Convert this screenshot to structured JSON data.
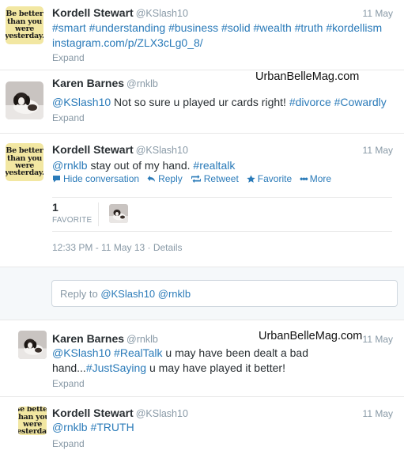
{
  "tweets": [
    {
      "fullname": "Kordell Stewart",
      "username": "@KSlash10",
      "time": "11 May",
      "line1": "#smart #understanding #business #solid #wealth #truth #kordellism",
      "line2": "instagram.com/p/ZLX3cLg0_8/",
      "expand": "Expand",
      "avatar_text": "Be better\nthan you\nwere\nyesterday."
    },
    {
      "fullname": "Karen Barnes",
      "username": "@rnklb",
      "time": "11 May",
      "mention": "@KSlash10",
      "body": " Not so sure u played ur cards right! ",
      "tag1": "#divorce",
      "tag2": "#Cowardly",
      "expand": "Expand",
      "watermark": "UrbanBelleMag.com"
    },
    {
      "fullname": "Kordell Stewart",
      "username": "@KSlash10",
      "time": "11 May",
      "mention": "@rnklb",
      "body": " stay out of my hand. ",
      "tag": "#realtalk",
      "avatar_text": "Be better\nthan you\nwere\nyesterday.",
      "actions": {
        "hide": "Hide conversation",
        "reply": "Reply",
        "retweet": "Retweet",
        "favorite": "Favorite",
        "more": "More"
      },
      "favorites_count": "1",
      "favorites_label": "FAVORITE",
      "meta": "12:33 PM - 11 May 13 · Details"
    },
    {
      "fullname": "Karen Barnes",
      "username": "@rnklb",
      "time": "11 May",
      "line1_mention": "@KSlash10",
      "line1_tag": "#RealTalk",
      "line1_rest": " u may have been dealt a bad",
      "line2_pre": "hand...",
      "line2_tag": "#JustSaying",
      "line2_rest": " u may have played it better!",
      "expand": "Expand",
      "watermark": "UrbanBelleMag.com"
    },
    {
      "fullname": "Kordell Stewart",
      "username": "@KSlash10",
      "time": "11 May",
      "mention": "@rnklb",
      "tag": "#TRUTH",
      "expand": "Expand",
      "avatar_text": "Be better\nthan you\nwere\nyesterday."
    }
  ],
  "reply": {
    "prefix": "Reply to ",
    "mentions": "@KSlash10 @rnklb"
  },
  "colors": {
    "link": "#2b7bb9",
    "muted": "#8899a6",
    "avatar_bg": "#f2e7a2"
  }
}
